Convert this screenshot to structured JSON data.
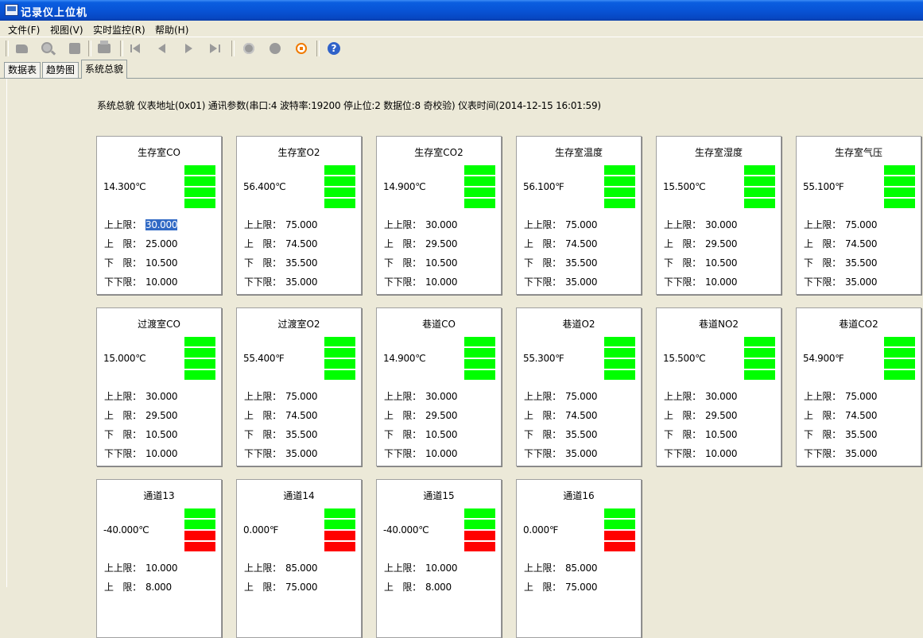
{
  "window": {
    "title": "记录仪上位机"
  },
  "menu": [
    "文件(F)",
    "视图(V)",
    "实时监控(R)",
    "帮助(H)"
  ],
  "toolbar": {
    "icons": [
      "open-icon",
      "search-icon",
      "save-icon",
      "print-icon",
      "first-icon",
      "previous-icon",
      "next-icon",
      "last-icon",
      "settings-icon",
      "record-icon",
      "stop-icon",
      "help-icon"
    ],
    "help_glyph": "?"
  },
  "tabs": [
    "数据表",
    "趋势图",
    "系统总貌"
  ],
  "active_tab": 2,
  "info": "系统总貌  仪表地址(0x01) 通讯参数(串口:4 波特率:19200 停止位:2 数据位:8 奇校验)  仪表时间(2014-12-15 16:01:59)",
  "colors": {
    "ok": "#00ff00",
    "alarm": "#ff0000"
  },
  "limit_labels": [
    "上上限：",
    "上　限：",
    "下　限：",
    "下下限："
  ],
  "cards": [
    {
      "title": "生存室CO",
      "value": "14.300℃",
      "bars": [
        "ok",
        "ok",
        "ok",
        "ok"
      ],
      "limits": [
        "30.000",
        "25.000",
        "10.500",
        "10.000"
      ]
    },
    {
      "title": "生存室O2",
      "value": "56.400℃",
      "bars": [
        "ok",
        "ok",
        "ok",
        "ok"
      ],
      "limits": [
        "75.000",
        "74.500",
        "35.500",
        "35.000"
      ]
    },
    {
      "title": "生存室CO2",
      "value": "14.900℃",
      "bars": [
        "ok",
        "ok",
        "ok",
        "ok"
      ],
      "limits": [
        "30.000",
        "29.500",
        "10.500",
        "10.000"
      ]
    },
    {
      "title": "生存室温度",
      "value": "56.100℉",
      "bars": [
        "ok",
        "ok",
        "ok",
        "ok"
      ],
      "limits": [
        "75.000",
        "74.500",
        "35.500",
        "35.000"
      ]
    },
    {
      "title": "生存室湿度",
      "value": "15.500℃",
      "bars": [
        "ok",
        "ok",
        "ok",
        "ok"
      ],
      "limits": [
        "30.000",
        "29.500",
        "10.500",
        "10.000"
      ]
    },
    {
      "title": "生存室气压",
      "value": "55.100℉",
      "bars": [
        "ok",
        "ok",
        "ok",
        "ok"
      ],
      "limits": [
        "75.000",
        "74.500",
        "35.500",
        "35.000"
      ]
    },
    {
      "title": "过渡室CO",
      "value": "15.000℃",
      "bars": [
        "ok",
        "ok",
        "ok",
        "ok"
      ],
      "limits": [
        "30.000",
        "29.500",
        "10.500",
        "10.000"
      ]
    },
    {
      "title": "过渡室O2",
      "value": "55.400℉",
      "bars": [
        "ok",
        "ok",
        "ok",
        "ok"
      ],
      "limits": [
        "75.000",
        "74.500",
        "35.500",
        "35.000"
      ]
    },
    {
      "title": "巷道CO",
      "value": "14.900℃",
      "bars": [
        "ok",
        "ok",
        "ok",
        "ok"
      ],
      "limits": [
        "30.000",
        "29.500",
        "10.500",
        "10.000"
      ]
    },
    {
      "title": "巷道O2",
      "value": "55.300℉",
      "bars": [
        "ok",
        "ok",
        "ok",
        "ok"
      ],
      "limits": [
        "75.000",
        "74.500",
        "35.500",
        "35.000"
      ]
    },
    {
      "title": "巷道NO2",
      "value": "15.500℃",
      "bars": [
        "ok",
        "ok",
        "ok",
        "ok"
      ],
      "limits": [
        "30.000",
        "29.500",
        "10.500",
        "10.000"
      ]
    },
    {
      "title": "巷道CO2",
      "value": "54.900℉",
      "bars": [
        "ok",
        "ok",
        "ok",
        "ok"
      ],
      "limits": [
        "75.000",
        "74.500",
        "35.500",
        "35.000"
      ]
    },
    {
      "title": "通道13",
      "value": "-40.000℃",
      "bars": [
        "ok",
        "ok",
        "alarm",
        "alarm"
      ],
      "limits": [
        "10.000",
        "8.000"
      ]
    },
    {
      "title": "通道14",
      "value": "0.000℉",
      "bars": [
        "ok",
        "ok",
        "alarm",
        "alarm"
      ],
      "limits": [
        "85.000",
        "75.000"
      ]
    },
    {
      "title": "通道15",
      "value": "-40.000℃",
      "bars": [
        "ok",
        "ok",
        "alarm",
        "alarm"
      ],
      "limits": [
        "10.000",
        "8.000"
      ]
    },
    {
      "title": "通道16",
      "value": "0.000℉",
      "bars": [
        "ok",
        "ok",
        "alarm",
        "alarm"
      ],
      "limits": [
        "85.000",
        "75.000"
      ]
    }
  ],
  "selected_value": {
    "card": 0,
    "limit": 0
  }
}
